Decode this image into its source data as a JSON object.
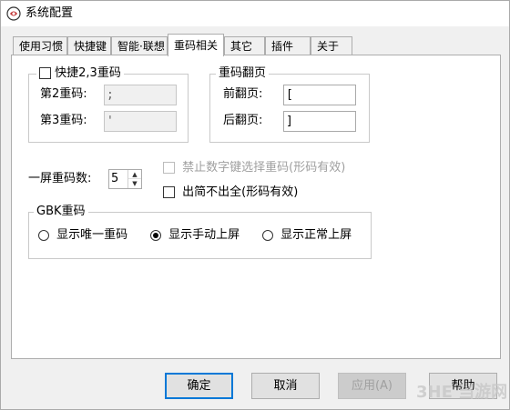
{
  "window": {
    "title": "系统配置"
  },
  "tabs": [
    {
      "label": "使用习惯",
      "active": false
    },
    {
      "label": "快捷键",
      "active": false
    },
    {
      "label": "智能·联想",
      "active": false
    },
    {
      "label": "重码相关",
      "active": true
    },
    {
      "label": "其它",
      "active": false
    },
    {
      "label": "插件",
      "active": false
    },
    {
      "label": "关于",
      "active": false
    }
  ],
  "quick_group": {
    "title": "快捷2,3重码",
    "checked": false,
    "second_label": "第2重码:",
    "second_value": ";",
    "third_label": "第3重码:",
    "third_value": "'"
  },
  "page_group": {
    "title": "重码翻页",
    "prev_label": "前翻页:",
    "prev_value": "[",
    "next_label": "后翻页:",
    "next_value": "]"
  },
  "per_screen": {
    "label": "一屏重码数:",
    "value": "5"
  },
  "options": {
    "disable_digit_label": "禁止数字键选择重码(形码有效)",
    "disable_digit_checked": false,
    "disable_digit_enabled": false,
    "simplified_label": "出简不出全(形码有效)",
    "simplified_checked": false
  },
  "gbk_group": {
    "title": "GBK重码",
    "options": [
      {
        "label": "显示唯一重码",
        "selected": false
      },
      {
        "label": "显示手动上屏",
        "selected": true
      },
      {
        "label": "显示正常上屏",
        "selected": false
      }
    ]
  },
  "buttons": {
    "ok": "确定",
    "cancel": "取消",
    "apply": "应用(A)",
    "help": "帮助"
  },
  "watermark": {
    "text": "3HE 当游网"
  },
  "colors": {
    "accent": "#0078d7",
    "disabled_text": "#a0a0a0",
    "watermark": "#c8c8c8"
  }
}
